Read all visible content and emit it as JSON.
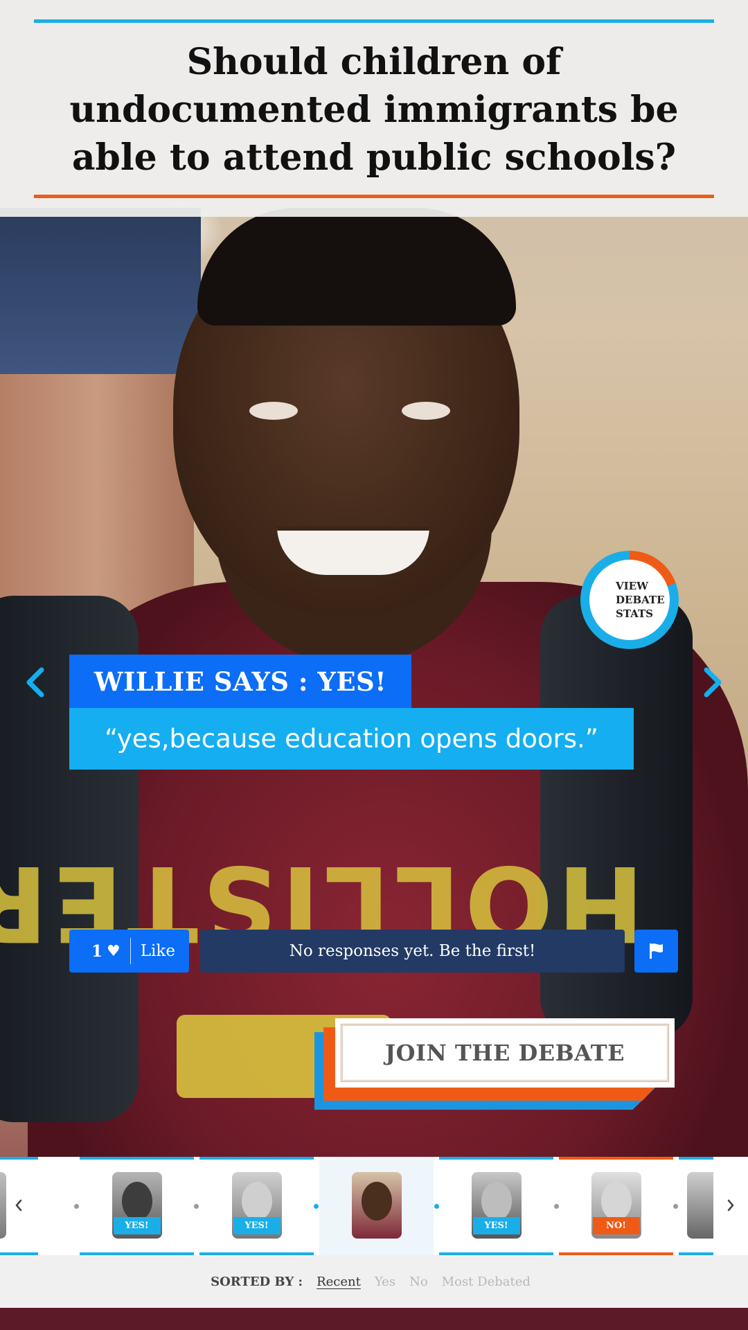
{
  "question": "Should children of undocumented immigrants be able to attend public schools?",
  "stats_button": {
    "label": "VIEW\nDEBATE\nSTATS"
  },
  "response": {
    "speaker_label": "WILLIE SAYS : YES!",
    "quote": "“yes,because education opens doors.”"
  },
  "actions": {
    "like_count": "1",
    "like_label": "Like",
    "responses_text": "No responses yet. Be the first!"
  },
  "join_button": {
    "label": "JOIN THE DEBATE"
  },
  "thumbnails": [
    {
      "stance": "yes",
      "badge": ""
    },
    {
      "stance": "yes",
      "badge": "YES!"
    },
    {
      "stance": "yes",
      "badge": "YES!"
    },
    {
      "stance": "yes",
      "badge": "",
      "active": true
    },
    {
      "stance": "yes",
      "badge": "YES!"
    },
    {
      "stance": "no",
      "badge": "NO!"
    },
    {
      "stance": "yes",
      "badge": ""
    }
  ],
  "sort": {
    "label": "SORTED BY :",
    "options": [
      "Recent",
      "Yes",
      "No",
      "Most Debated"
    ],
    "selected": "Recent"
  },
  "colors": {
    "accent_blue": "#0c6df7",
    "light_blue": "#14aef1",
    "orange": "#ef5b16",
    "navy": "#223a64"
  },
  "icons": [
    "chevron-left-icon",
    "chevron-right-icon",
    "heart-icon",
    "flag-icon"
  ]
}
